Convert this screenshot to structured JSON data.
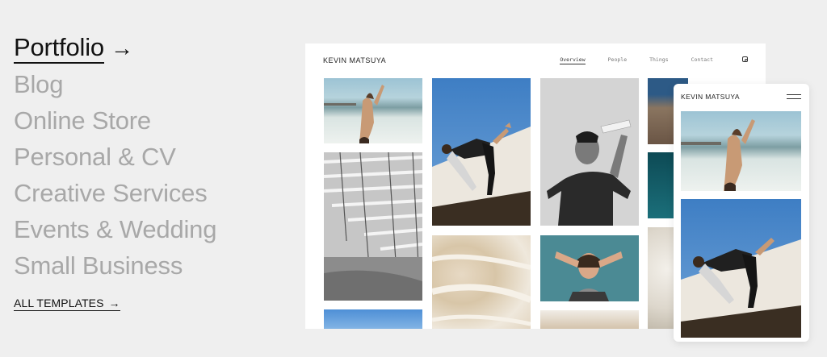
{
  "categories": [
    {
      "label": "Portfolio",
      "active": true
    },
    {
      "label": "Blog",
      "active": false
    },
    {
      "label": "Online Store",
      "active": false
    },
    {
      "label": "Personal & CV",
      "active": false
    },
    {
      "label": "Creative Services",
      "active": false
    },
    {
      "label": "Events & Wedding",
      "active": false
    },
    {
      "label": "Small Business",
      "active": false
    }
  ],
  "arrow_glyph": "→",
  "all_templates": {
    "label": "ALL TEMPLATES",
    "arrow": "→"
  },
  "desktop": {
    "brand": "KEVIN MATSUYA",
    "nav": [
      "Overview",
      "People",
      "Things",
      "Contact"
    ],
    "nav_active": "Overview",
    "social_icon": "instagram-icon"
  },
  "mobile": {
    "brand": "KEVIN MATSUYA",
    "menu_icon": "hamburger-menu-icon"
  },
  "colors": {
    "background": "#efefef",
    "active_text": "#111111",
    "inactive_text": "#a8a8a8",
    "card": "#ffffff"
  }
}
